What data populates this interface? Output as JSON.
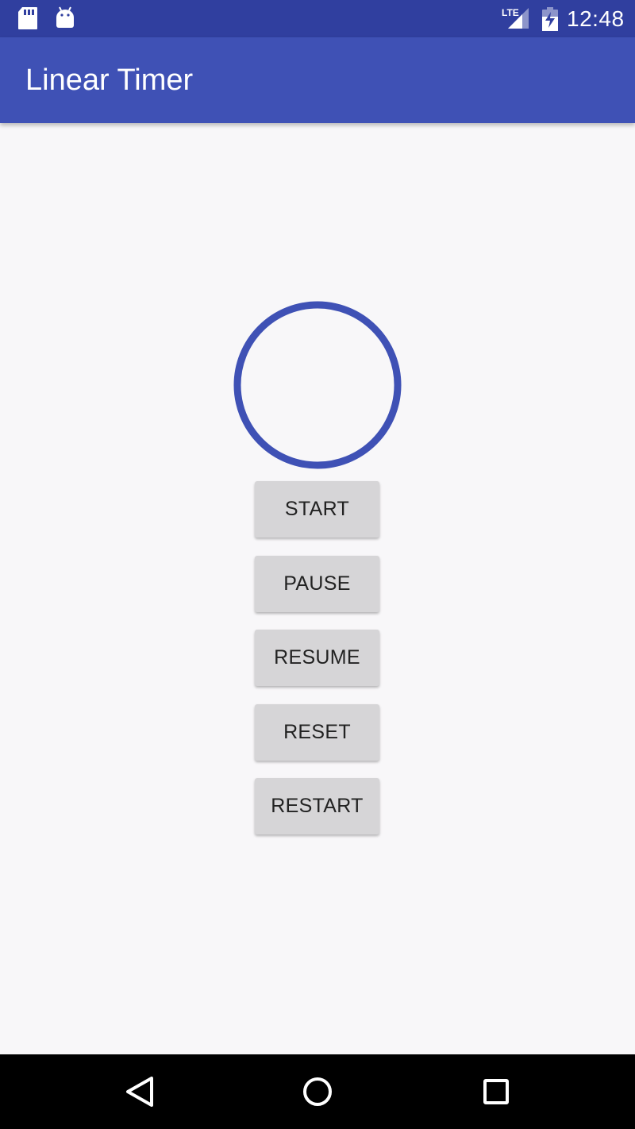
{
  "status_bar": {
    "time": "12:48",
    "network_label": "LTE",
    "icons": [
      "sd-card-icon",
      "android-icon",
      "lte-signal-icon",
      "battery-charging-icon"
    ]
  },
  "app_bar": {
    "title": "Linear Timer",
    "color": "#3f51b5",
    "status_color": "#303f9f"
  },
  "timer": {
    "ring_color": "#3f51b5"
  },
  "buttons": {
    "start": "START",
    "pause": "PAUSE",
    "resume": "RESUME",
    "reset": "RESET",
    "restart": "RESTART"
  },
  "nav_bar": {
    "icons": [
      "back-icon",
      "home-icon",
      "recents-icon"
    ]
  }
}
